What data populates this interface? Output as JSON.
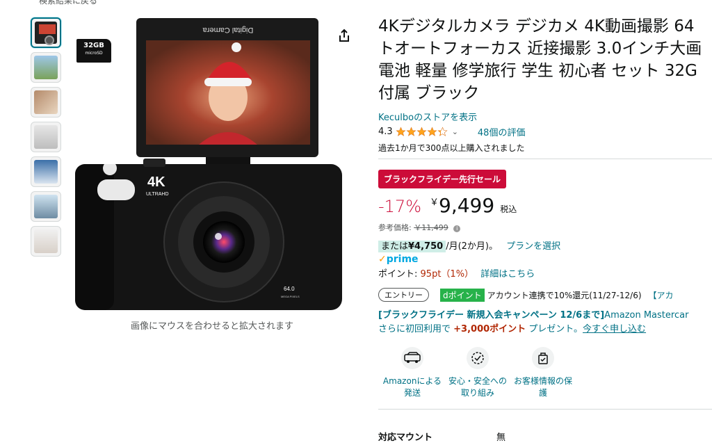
{
  "breadcrumb_cut": "検索結果に戻る",
  "sd_card": {
    "size": "32GB",
    "sub": "microSD"
  },
  "image_hint": "画像にマウスを合わせると拡大されます",
  "product": {
    "title_lines": [
      "4Kデジタルカメラ デジカメ 4K動画撮影 64",
      "トオートフォーカス 近接撮影 3.0インチ大画",
      "電池 軽量 修学旅行 学生 初心者 セット 32G",
      "付属 ブラック"
    ],
    "store_link": "Keculboのストアを表示",
    "rating": "4.3",
    "rating_value": 4.3,
    "review_count": "48個の評価",
    "bought": "過去1か月で300点以上購入されました"
  },
  "sale_badge": "ブラックフライデー先行セール",
  "price": {
    "discount": "-17%",
    "currency": "￥",
    "amount": "9,499",
    "tax": "税込",
    "ref_label": "参考価格:",
    "ref_price": "￥11,499"
  },
  "installment": {
    "prefix": "または",
    "amount": "¥4,750",
    "suffix": "/月(2か月)。",
    "link": "プランを選択"
  },
  "prime": "prime",
  "points": {
    "label": "ポイント:",
    "value": "95pt（1%）",
    "link": "詳細はこちら"
  },
  "entry": {
    "button": "エントリー",
    "dpoint": "dポイント",
    "text": "アカウント連携で10%還元(11/27-12/6)",
    "link": "【アカ"
  },
  "campaign": {
    "line1_bold": "[ブラックフライデー 新規入会キャンペーン 12/6まで]",
    "line1_rest": "Amazon Mastercar",
    "line2_a": "さらに初回利用で ",
    "line2_points": "+3,000ポイント",
    "line2_b": " プレゼント。",
    "line2_link": "今すぐ申し込む"
  },
  "features": [
    {
      "icon": "delivery-truck-icon",
      "label": "Amazonによる発送"
    },
    {
      "icon": "safety-badge-icon",
      "label": "安心・安全への取り組み"
    },
    {
      "icon": "privacy-lock-icon",
      "label": "お客様情報の保護"
    }
  ],
  "spec": {
    "key": "対応マウント",
    "value": "無"
  },
  "colors": {
    "link": "#007185",
    "sale": "#cc0c39",
    "star": "#ffa41c",
    "prime": "#00a8e1"
  }
}
